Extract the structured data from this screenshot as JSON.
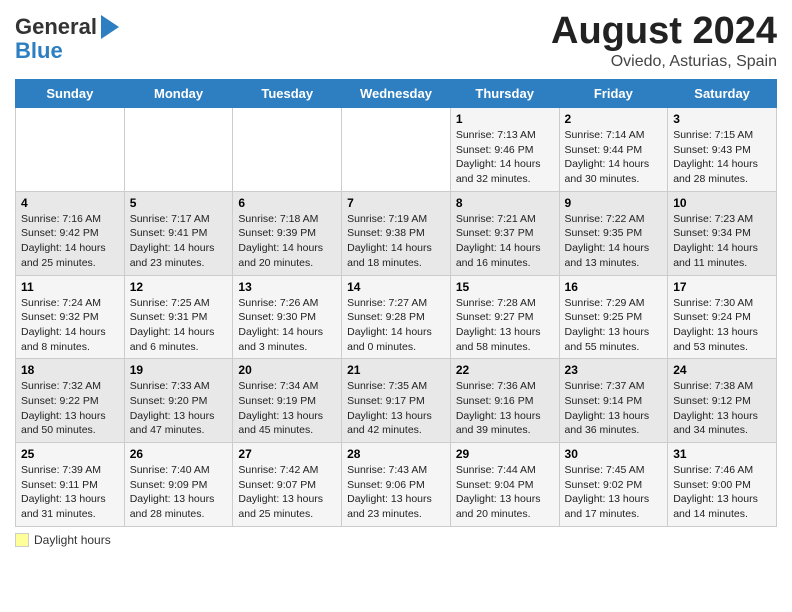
{
  "header": {
    "logo_line1": "General",
    "logo_line2": "Blue",
    "title": "August 2024",
    "subtitle": "Oviedo, Asturias, Spain"
  },
  "days_of_week": [
    "Sunday",
    "Monday",
    "Tuesday",
    "Wednesday",
    "Thursday",
    "Friday",
    "Saturday"
  ],
  "legend": {
    "label": "Daylight hours"
  },
  "weeks": [
    [
      {
        "day": "",
        "info": ""
      },
      {
        "day": "",
        "info": ""
      },
      {
        "day": "",
        "info": ""
      },
      {
        "day": "",
        "info": ""
      },
      {
        "day": "1",
        "info": "Sunrise: 7:13 AM\nSunset: 9:46 PM\nDaylight: 14 hours\nand 32 minutes."
      },
      {
        "day": "2",
        "info": "Sunrise: 7:14 AM\nSunset: 9:44 PM\nDaylight: 14 hours\nand 30 minutes."
      },
      {
        "day": "3",
        "info": "Sunrise: 7:15 AM\nSunset: 9:43 PM\nDaylight: 14 hours\nand 28 minutes."
      }
    ],
    [
      {
        "day": "4",
        "info": "Sunrise: 7:16 AM\nSunset: 9:42 PM\nDaylight: 14 hours\nand 25 minutes."
      },
      {
        "day": "5",
        "info": "Sunrise: 7:17 AM\nSunset: 9:41 PM\nDaylight: 14 hours\nand 23 minutes."
      },
      {
        "day": "6",
        "info": "Sunrise: 7:18 AM\nSunset: 9:39 PM\nDaylight: 14 hours\nand 20 minutes."
      },
      {
        "day": "7",
        "info": "Sunrise: 7:19 AM\nSunset: 9:38 PM\nDaylight: 14 hours\nand 18 minutes."
      },
      {
        "day": "8",
        "info": "Sunrise: 7:21 AM\nSunset: 9:37 PM\nDaylight: 14 hours\nand 16 minutes."
      },
      {
        "day": "9",
        "info": "Sunrise: 7:22 AM\nSunset: 9:35 PM\nDaylight: 14 hours\nand 13 minutes."
      },
      {
        "day": "10",
        "info": "Sunrise: 7:23 AM\nSunset: 9:34 PM\nDaylight: 14 hours\nand 11 minutes."
      }
    ],
    [
      {
        "day": "11",
        "info": "Sunrise: 7:24 AM\nSunset: 9:32 PM\nDaylight: 14 hours\nand 8 minutes."
      },
      {
        "day": "12",
        "info": "Sunrise: 7:25 AM\nSunset: 9:31 PM\nDaylight: 14 hours\nand 6 minutes."
      },
      {
        "day": "13",
        "info": "Sunrise: 7:26 AM\nSunset: 9:30 PM\nDaylight: 14 hours\nand 3 minutes."
      },
      {
        "day": "14",
        "info": "Sunrise: 7:27 AM\nSunset: 9:28 PM\nDaylight: 14 hours\nand 0 minutes."
      },
      {
        "day": "15",
        "info": "Sunrise: 7:28 AM\nSunset: 9:27 PM\nDaylight: 13 hours\nand 58 minutes."
      },
      {
        "day": "16",
        "info": "Sunrise: 7:29 AM\nSunset: 9:25 PM\nDaylight: 13 hours\nand 55 minutes."
      },
      {
        "day": "17",
        "info": "Sunrise: 7:30 AM\nSunset: 9:24 PM\nDaylight: 13 hours\nand 53 minutes."
      }
    ],
    [
      {
        "day": "18",
        "info": "Sunrise: 7:32 AM\nSunset: 9:22 PM\nDaylight: 13 hours\nand 50 minutes."
      },
      {
        "day": "19",
        "info": "Sunrise: 7:33 AM\nSunset: 9:20 PM\nDaylight: 13 hours\nand 47 minutes."
      },
      {
        "day": "20",
        "info": "Sunrise: 7:34 AM\nSunset: 9:19 PM\nDaylight: 13 hours\nand 45 minutes."
      },
      {
        "day": "21",
        "info": "Sunrise: 7:35 AM\nSunset: 9:17 PM\nDaylight: 13 hours\nand 42 minutes."
      },
      {
        "day": "22",
        "info": "Sunrise: 7:36 AM\nSunset: 9:16 PM\nDaylight: 13 hours\nand 39 minutes."
      },
      {
        "day": "23",
        "info": "Sunrise: 7:37 AM\nSunset: 9:14 PM\nDaylight: 13 hours\nand 36 minutes."
      },
      {
        "day": "24",
        "info": "Sunrise: 7:38 AM\nSunset: 9:12 PM\nDaylight: 13 hours\nand 34 minutes."
      }
    ],
    [
      {
        "day": "25",
        "info": "Sunrise: 7:39 AM\nSunset: 9:11 PM\nDaylight: 13 hours\nand 31 minutes."
      },
      {
        "day": "26",
        "info": "Sunrise: 7:40 AM\nSunset: 9:09 PM\nDaylight: 13 hours\nand 28 minutes."
      },
      {
        "day": "27",
        "info": "Sunrise: 7:42 AM\nSunset: 9:07 PM\nDaylight: 13 hours\nand 25 minutes."
      },
      {
        "day": "28",
        "info": "Sunrise: 7:43 AM\nSunset: 9:06 PM\nDaylight: 13 hours\nand 23 minutes."
      },
      {
        "day": "29",
        "info": "Sunrise: 7:44 AM\nSunset: 9:04 PM\nDaylight: 13 hours\nand 20 minutes."
      },
      {
        "day": "30",
        "info": "Sunrise: 7:45 AM\nSunset: 9:02 PM\nDaylight: 13 hours\nand 17 minutes."
      },
      {
        "day": "31",
        "info": "Sunrise: 7:46 AM\nSunset: 9:00 PM\nDaylight: 13 hours\nand 14 minutes."
      }
    ]
  ]
}
